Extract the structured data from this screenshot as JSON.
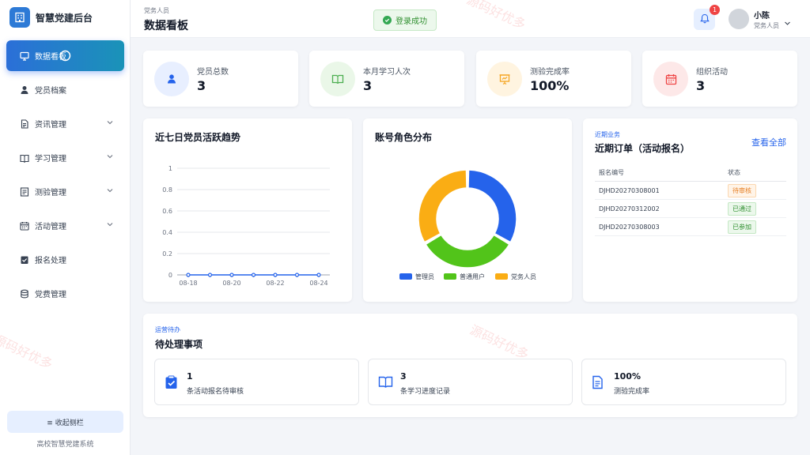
{
  "app": {
    "title": "智慧党建后台",
    "system_name": "高校智慧党建系统"
  },
  "sidebar": {
    "items": [
      {
        "label": "数据看板",
        "icon": "monitor-icon",
        "active": true,
        "expandable": false
      },
      {
        "label": "党员档案",
        "icon": "user-icon",
        "active": false,
        "expandable": false
      },
      {
        "label": "资讯管理",
        "icon": "document-icon",
        "active": false,
        "expandable": true
      },
      {
        "label": "学习管理",
        "icon": "book-icon",
        "active": false,
        "expandable": true
      },
      {
        "label": "测验管理",
        "icon": "quiz-icon",
        "active": false,
        "expandable": true
      },
      {
        "label": "活动管理",
        "icon": "calendar-icon",
        "active": false,
        "expandable": true
      },
      {
        "label": "报名处理",
        "icon": "checklist-icon",
        "active": false,
        "expandable": false
      },
      {
        "label": "党费管理",
        "icon": "database-icon",
        "active": false,
        "expandable": false
      }
    ],
    "collapse_label": "≡ 收起侧栏"
  },
  "header": {
    "breadcrumb": "党务人员",
    "title": "数据看板",
    "toast": "登录成功",
    "notification_count": "1",
    "user_name": "小陈",
    "user_role": "党务人员"
  },
  "stats": [
    {
      "label": "党员总数",
      "value": "3",
      "icon": "user-icon",
      "color": "#2563eb",
      "bg": "#e8efff"
    },
    {
      "label": "本月学习人次",
      "value": "3",
      "icon": "book-open-icon",
      "color": "#4caf50",
      "bg": "#eaf7e8"
    },
    {
      "label": "测验完成率",
      "value": "100%",
      "icon": "presentation-icon",
      "color": "#f5a623",
      "bg": "#fff4e0"
    },
    {
      "label": "组织活动",
      "value": "3",
      "icon": "calendar-icon",
      "color": "#ef4444",
      "bg": "#fde8e8"
    }
  ],
  "trend": {
    "title": "近七日党员活跃趋势",
    "chart_data": {
      "type": "line",
      "x": [
        "08-18",
        "08-19",
        "08-20",
        "08-21",
        "08-22",
        "08-23",
        "08-24"
      ],
      "x_tick_labels": [
        "08-18",
        "08-20",
        "08-22",
        "08-24"
      ],
      "series": [
        {
          "values": [
            0,
            0,
            0,
            0,
            0,
            0,
            0
          ],
          "color": "#2563eb"
        }
      ],
      "ylim": [
        0,
        1
      ],
      "y_ticks": [
        "0",
        "0.2",
        "0.4",
        "0.6",
        "0.8",
        "1"
      ],
      "grid": true
    }
  },
  "roles": {
    "title": "账号角色分布",
    "chart_data": {
      "type": "pie",
      "categories": [
        "管理员",
        "普通用户",
        "党务人员"
      ],
      "values": [
        1,
        1,
        1
      ],
      "colors": [
        "#2563eb",
        "#52c41a",
        "#faad14"
      ],
      "legend": "bottom"
    }
  },
  "orders": {
    "tag": "近期业务",
    "title": "近期订单（活动报名）",
    "view_all": "查看全部",
    "columns": [
      "报名编号",
      "状态"
    ],
    "rows": [
      {
        "id": "DJHD20270308001",
        "status": "待审核",
        "type": "warn"
      },
      {
        "id": "DJHD20270312002",
        "status": "已通过",
        "type": "ok"
      },
      {
        "id": "DJHD20270308003",
        "status": "已参加",
        "type": "ok"
      }
    ]
  },
  "todos": {
    "tag": "运营待办",
    "title": "待处理事项",
    "items": [
      {
        "num": "1",
        "text": "条活动报名待审核",
        "icon": "clipboard-check-icon"
      },
      {
        "num": "3",
        "text": "条学习进度记录",
        "icon": "book-open-icon"
      },
      {
        "num": "100%",
        "text": "测验完成率",
        "icon": "document-icon"
      }
    ]
  },
  "watermark": "源码好优多"
}
